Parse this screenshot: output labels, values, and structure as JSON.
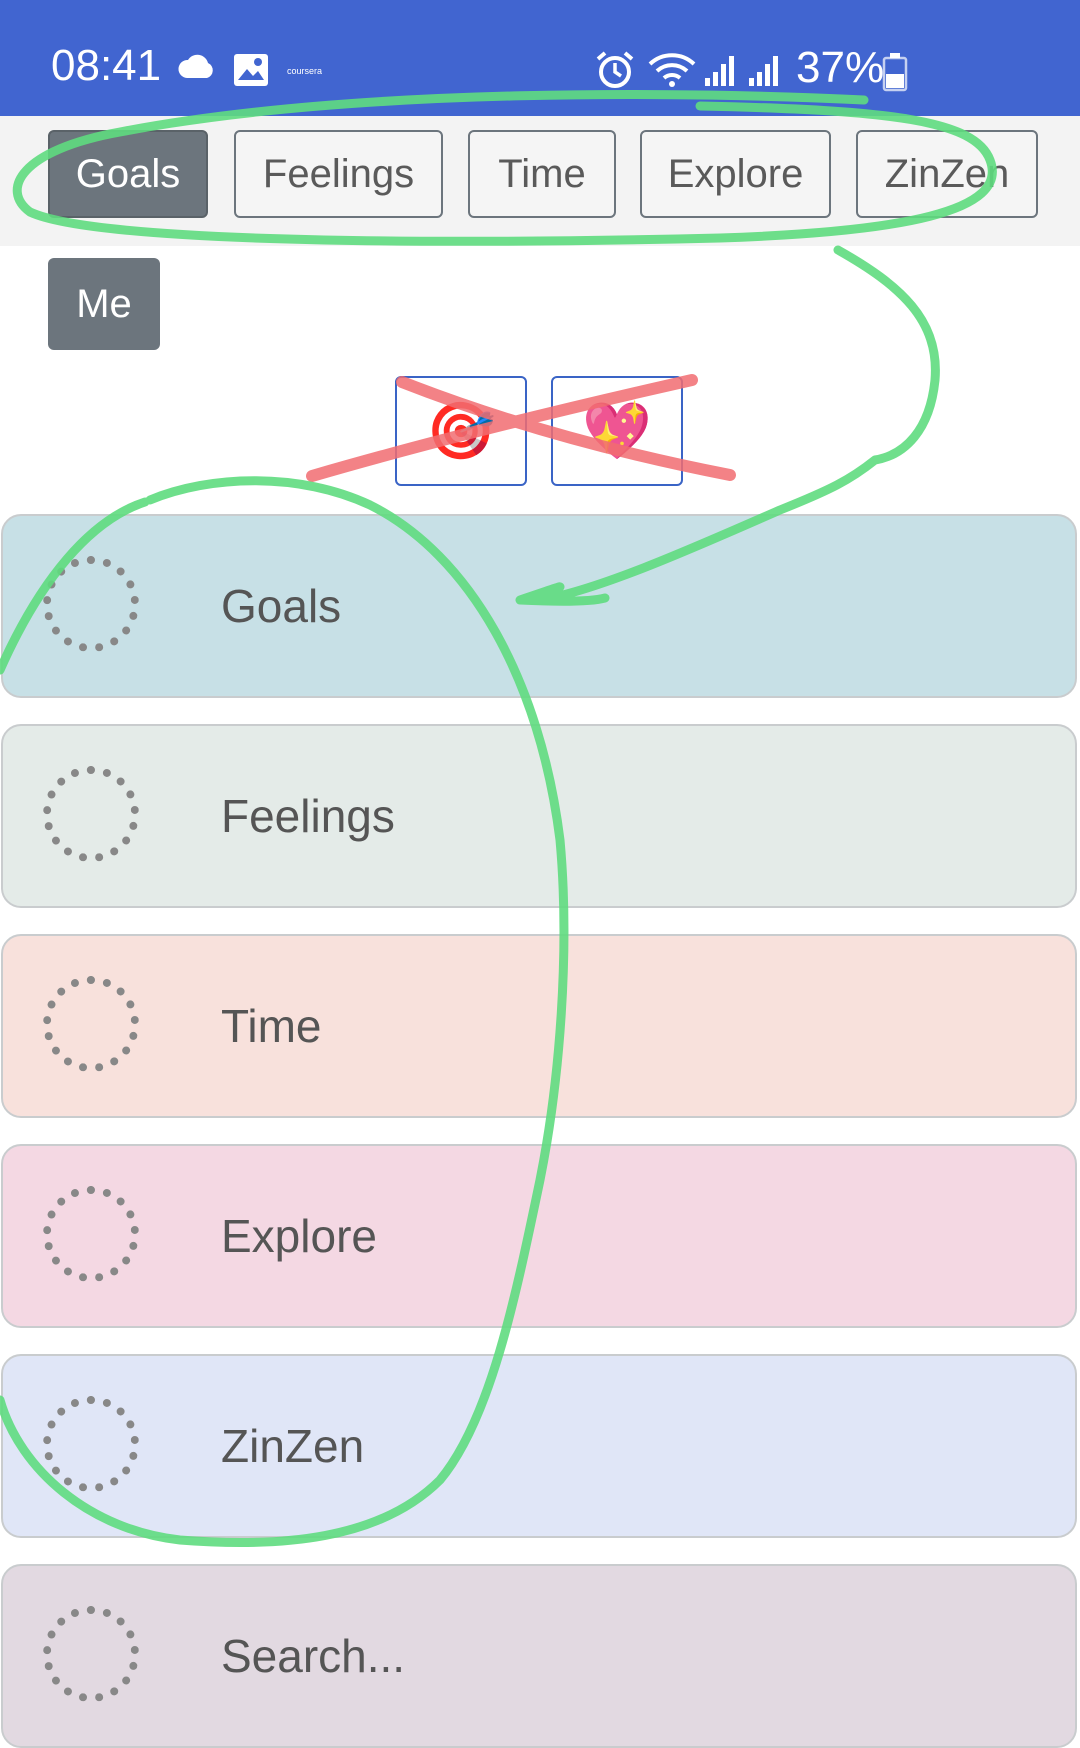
{
  "status_bar": {
    "time": "08:41",
    "app_label": "coursera",
    "battery": "37%",
    "icons": [
      "cloud-icon",
      "image-icon",
      "alarm-icon",
      "wifi-icon",
      "signal-icon",
      "battery-icon"
    ]
  },
  "nav": {
    "tabs": [
      "Goals",
      "Feelings",
      "Time",
      "Explore",
      "ZinZen"
    ],
    "active": "Goals",
    "me_label": "Me"
  },
  "emoji_buttons": [
    {
      "emoji": "🎯",
      "icon": "target-icon"
    },
    {
      "emoji": "💖",
      "icon": "sparkling-heart-icon"
    }
  ],
  "rows": [
    {
      "label": "Goals",
      "color": "#c7e0e6"
    },
    {
      "label": "Feelings",
      "color": "#e4ebe8"
    },
    {
      "label": "Time",
      "color": "#f8e1dc"
    },
    {
      "label": "Explore",
      "color": "#f4d8e3"
    },
    {
      "label": "ZinZen",
      "color": "#e0e6f7"
    },
    {
      "label": "Search...",
      "color": "#e2d9e1"
    }
  ],
  "colors": {
    "status_bar": "#4165d0",
    "annotation_green": "#5fdc7f",
    "annotation_red": "#f26d71"
  }
}
